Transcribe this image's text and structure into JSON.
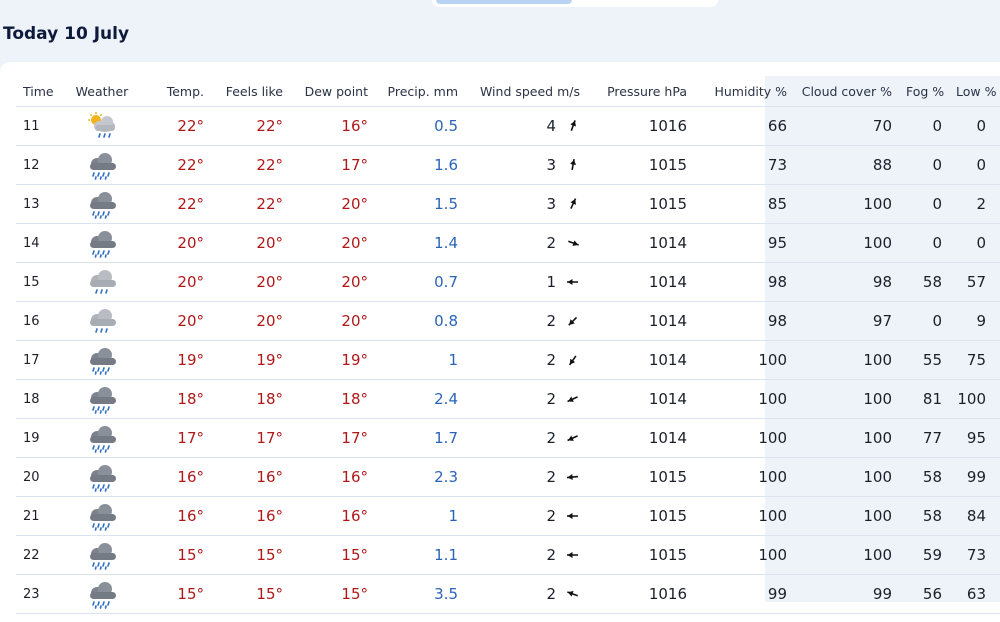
{
  "title": "Today 10 July",
  "columns": [
    "Time",
    "Weather",
    "Temp.",
    "Feels like",
    "Dew point",
    "Precip. mm",
    "Wind speed m/s",
    "Pressure hPa",
    "Humidity %",
    "Cloud cover %",
    "Fog %",
    "Low %"
  ],
  "rows": [
    {
      "time": "11",
      "icon": "partly-sunny-rain-icon",
      "temp": "22°",
      "feels": "22°",
      "dew": "16°",
      "precip": "0.5",
      "wind": "4",
      "wind_dir_deg": 200,
      "pressure": "1016",
      "humidity": "66",
      "cloud": "70",
      "fog": "0",
      "low": "0"
    },
    {
      "time": "12",
      "icon": "rain-cloud-icon",
      "temp": "22°",
      "feels": "22°",
      "dew": "17°",
      "precip": "1.6",
      "wind": "3",
      "wind_dir_deg": 190,
      "pressure": "1015",
      "humidity": "73",
      "cloud": "88",
      "fog": "0",
      "low": "0"
    },
    {
      "time": "13",
      "icon": "rain-cloud-icon",
      "temp": "22°",
      "feels": "22°",
      "dew": "20°",
      "precip": "1.5",
      "wind": "3",
      "wind_dir_deg": 205,
      "pressure": "1015",
      "humidity": "85",
      "cloud": "100",
      "fog": "0",
      "low": "2"
    },
    {
      "time": "14",
      "icon": "rain-cloud-icon",
      "temp": "20°",
      "feels": "20°",
      "dew": "20°",
      "precip": "1.4",
      "wind": "2",
      "wind_dir_deg": 290,
      "pressure": "1014",
      "humidity": "95",
      "cloud": "100",
      "fog": "0",
      "low": "0"
    },
    {
      "time": "15",
      "icon": "light-rain-cloud-icon",
      "temp": "20°",
      "feels": "20°",
      "dew": "20°",
      "precip": "0.7",
      "wind": "1",
      "wind_dir_deg": 90,
      "pressure": "1014",
      "humidity": "98",
      "cloud": "98",
      "fog": "58",
      "low": "57"
    },
    {
      "time": "16",
      "icon": "light-rain-cloud-icon",
      "temp": "20°",
      "feels": "20°",
      "dew": "20°",
      "precip": "0.8",
      "wind": "2",
      "wind_dir_deg": 45,
      "pressure": "1014",
      "humidity": "98",
      "cloud": "97",
      "fog": "0",
      "low": "9"
    },
    {
      "time": "17",
      "icon": "rain-cloud-icon",
      "temp": "19°",
      "feels": "19°",
      "dew": "19°",
      "precip": "1",
      "wind": "2",
      "wind_dir_deg": 35,
      "pressure": "1014",
      "humidity": "100",
      "cloud": "100",
      "fog": "55",
      "low": "75"
    },
    {
      "time": "18",
      "icon": "rain-cloud-icon",
      "temp": "18°",
      "feels": "18°",
      "dew": "18°",
      "precip": "2.4",
      "wind": "2",
      "wind_dir_deg": 65,
      "pressure": "1014",
      "humidity": "100",
      "cloud": "100",
      "fog": "81",
      "low": "100"
    },
    {
      "time": "19",
      "icon": "rain-cloud-icon",
      "temp": "17°",
      "feels": "17°",
      "dew": "17°",
      "precip": "1.7",
      "wind": "2",
      "wind_dir_deg": 65,
      "pressure": "1014",
      "humidity": "100",
      "cloud": "100",
      "fog": "77",
      "low": "95"
    },
    {
      "time": "20",
      "icon": "rain-cloud-icon",
      "temp": "16°",
      "feels": "16°",
      "dew": "16°",
      "precip": "2.3",
      "wind": "2",
      "wind_dir_deg": 85,
      "pressure": "1015",
      "humidity": "100",
      "cloud": "100",
      "fog": "58",
      "low": "99"
    },
    {
      "time": "21",
      "icon": "rain-cloud-icon",
      "temp": "16°",
      "feels": "16°",
      "dew": "16°",
      "precip": "1",
      "wind": "2",
      "wind_dir_deg": 90,
      "pressure": "1015",
      "humidity": "100",
      "cloud": "100",
      "fog": "58",
      "low": "84"
    },
    {
      "time": "22",
      "icon": "rain-cloud-icon",
      "temp": "15°",
      "feels": "15°",
      "dew": "15°",
      "precip": "1.1",
      "wind": "2",
      "wind_dir_deg": 90,
      "pressure": "1015",
      "humidity": "100",
      "cloud": "100",
      "fog": "59",
      "low": "73"
    },
    {
      "time": "23",
      "icon": "rain-cloud-icon",
      "temp": "15°",
      "feels": "15°",
      "dew": "15°",
      "precip": "3.5",
      "wind": "2",
      "wind_dir_deg": 110,
      "pressure": "1016",
      "humidity": "99",
      "cloud": "99",
      "fog": "56",
      "low": "63"
    }
  ],
  "colors": {
    "temp": "#b01818",
    "precip": "#2a64b8",
    "cloud_column_bg": "#eef3fa",
    "rain": "#2f6fc4"
  }
}
